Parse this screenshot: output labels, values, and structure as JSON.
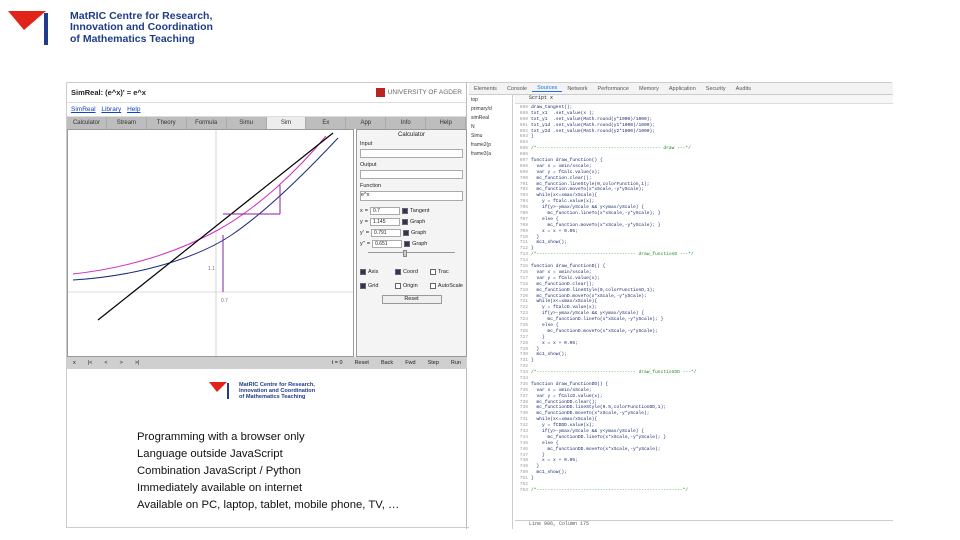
{
  "slide_logo": {
    "text": [
      "MatRIC Centre for Research,",
      "Innovation and Coordination",
      "of Mathematics Teaching"
    ]
  },
  "app": {
    "title": "SimReal: (e^x)' = e^x",
    "university": "UNIVERSITY OF AGDER",
    "links": [
      "SimReal",
      "Library",
      "Help"
    ],
    "tabs": [
      "Calculator",
      "Stream",
      "Theory",
      "Formula",
      "Simu",
      "Sim",
      "Ex",
      "App",
      "Info",
      "Help"
    ],
    "active_tab": "Sim",
    "side": {
      "heading": "Calculator",
      "input": "Input",
      "output": "Output",
      "function": "Function",
      "function_value": "e^x",
      "rows": [
        {
          "var": "x",
          "value": "0.7",
          "label": "Tangent"
        },
        {
          "var": "y",
          "value": "1.145",
          "label": "Graph"
        },
        {
          "var": "y'",
          "value": "0.791",
          "label": "Graph"
        },
        {
          "var": "y''",
          "value": "0.651",
          "label": "Graph"
        }
      ],
      "options": [
        "Axis",
        "Coord",
        "Trac",
        "Grid",
        "Origin",
        "AutoScale"
      ],
      "reset": "Reset"
    },
    "ctrl_left": [
      "x",
      "|<",
      "<",
      ">",
      ">|"
    ],
    "ctrl_status": "t = 0",
    "ctrl_buttons": [
      "Reset",
      "Back",
      "Fwd",
      "Step",
      "Run"
    ]
  },
  "app_logo": {
    "text": [
      "MatRIC Centre for Research,",
      "Innovation and Coordination",
      "of Mathematics Teaching"
    ]
  },
  "bullets": [
    "Programming with a browser only",
    "Language outside JavaScript",
    "Combination JavaScript / Python",
    "Immediately available on internet",
    "Available on PC, laptop, tablet, mobile phone, TV, …"
  ],
  "devtools": {
    "tabs": [
      "Elements",
      "Console",
      "Sources",
      "Network",
      "Performance",
      "Memory",
      "Application",
      "Security",
      "Audits"
    ],
    "active_tab": "Sources",
    "tree": [
      "top",
      "primary/d",
      "simReal",
      "N",
      "Simu",
      "frame2(p",
      "frame3(a"
    ],
    "file": "Script x",
    "status": "Line 906, Column 175",
    "code_start": 688,
    "code": [
      "draw_tangent();",
      "txt_x1  .set_value(x );",
      "txt_y1  .set_value(Math.round(y*1000)/1000);",
      "txt_y1d .set_value(Math.round(y1*1000)/1000);",
      "txt_y2d .set_value(Math.round(y2*1000)/1000);",
      "}",
      "",
      "/*--------------------------------------------- draw ---*/",
      "",
      "function draw_function() {",
      "  var x = xmin/xscale;",
      "  var y = fCalc.value(x);",
      "  mc_function.clear();",
      "  mc_function.lineStyle(0,colorFunction,1);",
      "  mc_function.moveTo(x*xScale,-y*yScale);",
      "  while(x<=xmax/xScale){",
      "    y = fCalc.value(x);",
      "    if(y>-ymax/yScale && y<ymax/yScale) {",
      "      mc_function.lineTo(x*xScale,-y*yScale); }",
      "    else {",
      "      mc_function.moveTo(x*xScale,-y*yScale); }",
      "    x = x + 0.05;",
      "  }",
      "  mc1_show();",
      "}",
      "/*------------------------------------ draw_functionD ---*/",
      "",
      "function draw_functionD() {",
      "  var x = xmin/xscale;",
      "  var y = fCalc.value(x);",
      "  mc_functionD.clear();",
      "  mc_functionD.lineStyle(0,colorFunctionD,1);",
      "  mc_functionD.moveTo(x*xScale,-y*yScale);",
      "  while(x<=xmax/xScale){",
      "    y = fCalcD.value(x);",
      "    if(y>-ymax/yScale && y<ymax/yScale) {",
      "      mc_functionD.lineTo(x*xScale,-y*yScale); }",
      "    else {",
      "      mc_functionD.moveTo(x*xScale,-y*yScale);",
      "    }",
      "    x = x + 0.05;",
      "  }",
      "  mc1_show();",
      "}",
      "",
      "/*------------------------------------ draw_functionDD ---*/",
      "",
      "function draw_functionDD() {",
      "  var x = xmin/xScale;",
      "  var y = fCalcD.value(x);",
      "  mc_functionDD.clear();",
      "  mc_functionDD.lineStyle(0.5,colorFunctionDD,1);",
      "  mc_functionDD.moveTo(x*xScale,-y*yScale);",
      "  while(x<=xmax/xScale){",
      "    y = fCDDD.value(x);",
      "    if(y>-ymax/yScale && y<ymax/yScale) {",
      "      mc_functionDD.lineTo(x*xScale,-y*yScale); }",
      "    else {",
      "      mc_functionDD.moveTo(x*xScale,-y*yScale);",
      "    }",
      "    x = x + 0.05;",
      "  }",
      "  mc1_show();",
      "}",
      "",
      "/*-----------------------------------------------------*/"
    ]
  },
  "colors": {
    "brand_blue": "#1f3c88",
    "brand_red": "#e2231a",
    "curve_pink": "#d030c0",
    "curve_navy": "#1c2a80",
    "tangent": "#000000",
    "marker": "#8020a0"
  }
}
